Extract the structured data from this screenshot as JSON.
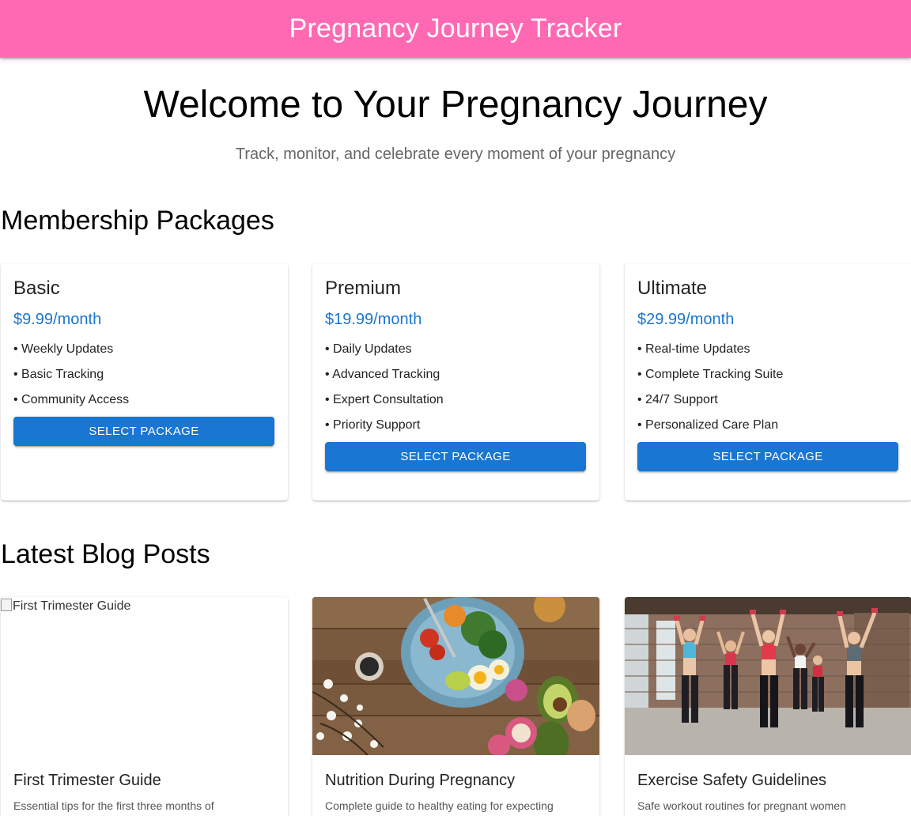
{
  "appbar": {
    "title": "Pregnancy Journey Tracker",
    "color": "#ff69b4"
  },
  "hero": {
    "title": "Welcome to Your Pregnancy Journey",
    "subtitle": "Track, monitor, and celebrate every moment of your pregnancy"
  },
  "membership": {
    "title": "Membership Packages",
    "packages": [
      {
        "name": "Basic",
        "price": "$9.99/month",
        "features": [
          "• Weekly Updates",
          "• Basic Tracking",
          "• Community Access"
        ],
        "button": "SELECT PACKAGE"
      },
      {
        "name": "Premium",
        "price": "$19.99/month",
        "features": [
          "• Daily Updates",
          "• Advanced Tracking",
          "• Expert Consultation",
          "• Priority Support"
        ],
        "button": "SELECT PACKAGE"
      },
      {
        "name": "Ultimate",
        "price": "$29.99/month",
        "features": [
          "• Real-time Updates",
          "• Complete Tracking Suite",
          "• 24/7 Support",
          "• Personalized Care Plan"
        ],
        "button": "SELECT PACKAGE"
      }
    ]
  },
  "blog": {
    "title": "Latest Blog Posts",
    "posts": [
      {
        "image_alt": "First Trimester Guide",
        "title": "First Trimester Guide",
        "excerpt": "Essential tips for the first three months of"
      },
      {
        "image_alt": "Nutrition During Pregnancy",
        "title": "Nutrition During Pregnancy",
        "excerpt": "Complete guide to healthy eating for expecting"
      },
      {
        "image_alt": "Exercise Safety Guidelines",
        "title": "Exercise Safety Guidelines",
        "excerpt": "Safe workout routines for pregnant women"
      }
    ]
  },
  "colors": {
    "accent": "#1976d2",
    "brand": "#ff69b4"
  }
}
